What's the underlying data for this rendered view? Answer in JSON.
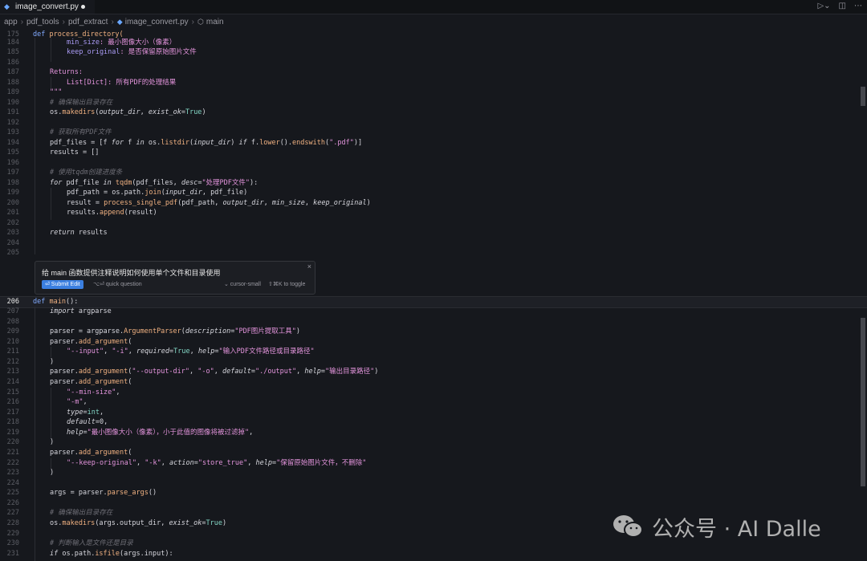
{
  "tab": {
    "filename": "image_convert.py"
  },
  "breadcrumbs": [
    "app",
    "pdf_tools",
    "pdf_extract",
    "image_convert.py",
    "main"
  ],
  "watermark": {
    "text": "公众号 · AI Dalle"
  },
  "inline_edit": {
    "prompt": "给 main 函数提供注释说明如何使用单个文件和目录使用",
    "submit_label": "⏎ Submit Edit",
    "quick_label": "⌥⏎ quick question",
    "model_label": "⌄ cursor-small",
    "toggle_label": "⇧⌘K to toggle"
  },
  "line_numbers": [
    "175",
    "184",
    "185",
    "186",
    "187",
    "188",
    "189",
    "190",
    "191",
    "192",
    "193",
    "194",
    "195",
    "196",
    "197",
    "198",
    "199",
    "200",
    "201",
    "202",
    "203",
    "204",
    "205",
    "206",
    "207",
    "208",
    "209",
    "210",
    "211",
    "212",
    "213",
    "214",
    "215",
    "216",
    "217",
    "218",
    "219",
    "220",
    "221",
    "222",
    "223",
    "224",
    "225",
    "226",
    "227",
    "228",
    "229",
    "230",
    "231"
  ],
  "code": {
    "l175_kw": "def ",
    "l175_fn": "process_directory(",
    "l184_a": "min_size",
    "l184_b": ": 最小图像大小（像素）",
    "l185_a": "keep_original",
    "l185_b": ": 是否保留原始图片文件",
    "l187": "Returns:",
    "l188": "List[Dict]: 所有PDF的处理结果",
    "l189": "\"\"\"",
    "l190": "# 确保输出目录存在",
    "l191_a": "os.",
    "l191_fn": "makedirs",
    "l191_b": "(",
    "l191_p1": "output_dir",
    "l191_c": ", ",
    "l191_p2": "exist_ok",
    "l191_d": "=",
    "l191_e": "True",
    "l191_f": ")",
    "l193": "# 获取所有PDF文件",
    "l194_a": "pdf_files = [f ",
    "l194_kw1": "for",
    "l194_b": " f ",
    "l194_kw2": "in",
    "l194_c": " os.",
    "l194_fn": "listdir",
    "l194_d": "(",
    "l194_p": "input_dir",
    "l194_e": ") ",
    "l194_kw3": "if",
    "l194_f": " f.",
    "l194_fn2": "lower",
    "l194_g": "().",
    "l194_fn3": "endswith",
    "l194_h": "(",
    "l194_s": "\".pdf\"",
    "l194_i": ")]",
    "l195": "results = []",
    "l197": "# 使用tqdm创建进度条",
    "l198_kw": "for",
    "l198_a": " pdf_file ",
    "l198_kw2": "in",
    "l198_b": " ",
    "l198_fn": "tqdm",
    "l198_c": "(pdf_files, ",
    "l198_p": "desc",
    "l198_d": "=",
    "l198_s": "\"处理PDF文件\"",
    "l198_e": "):",
    "l199_a": "pdf_path = os.path.",
    "l199_fn": "join",
    "l199_b": "(",
    "l199_p": "input_dir",
    "l199_c": ", pdf_file)",
    "l200_a": "result = ",
    "l200_fn": "process_single_pdf",
    "l200_b": "(pdf_path, ",
    "l200_p1": "output_dir",
    "l200_c": ", ",
    "l200_p2": "min_size",
    "l200_d": ", ",
    "l200_p3": "keep_original",
    "l200_e": ")",
    "l201_a": "results.",
    "l201_fn": "append",
    "l201_b": "(result)",
    "l203_kw": "return",
    "l203_a": " results",
    "l206_kw": "def ",
    "l206_fn": "main",
    "l206_a": "():",
    "l207_kw": "import",
    "l207_a": " argparse",
    "l209_a": "parser = argparse.",
    "l209_fn": "ArgumentParser",
    "l209_b": "(",
    "l209_p": "description",
    "l209_c": "=",
    "l209_s": "\"PDF图片提取工具\"",
    "l209_d": ")",
    "l210_a": "parser.",
    "l210_fn": "add_argument",
    "l210_b": "(",
    "l211_s1": "\"--input\"",
    "l211_a": ", ",
    "l211_s2": "\"-i\"",
    "l211_b": ", ",
    "l211_p": "required",
    "l211_c": "=",
    "l211_v": "True",
    "l211_d": ", ",
    "l211_p2": "help",
    "l211_e": "=",
    "l211_s3": "\"输入PDF文件路径或目录路径\"",
    "l212": ")",
    "l213_a": "parser.",
    "l213_fn": "add_argument",
    "l213_b": "(",
    "l213_s1": "\"--output-dir\"",
    "l213_c": ", ",
    "l213_s2": "\"-o\"",
    "l213_d": ", ",
    "l213_p": "default",
    "l213_e": "=",
    "l213_s3": "\"./output\"",
    "l213_f": ", ",
    "l213_p2": "help",
    "l213_g": "=",
    "l213_s4": "\"输出目录路径\"",
    "l213_h": ")",
    "l214_a": "parser.",
    "l214_fn": "add_argument",
    "l214_b": "(",
    "l215_s": "\"--min-size\"",
    "l215_a": ",",
    "l216_s": "\"-m\"",
    "l216_a": ",",
    "l217_p": "type",
    "l217_a": "=",
    "l217_v": "int",
    "l217_b": ",",
    "l218_p": "default",
    "l218_a": "=0,",
    "l219_p": "help",
    "l219_a": "=",
    "l219_s": "\"最小图像大小（像素），小于此值的图像将被过滤掉\"",
    "l219_b": ",",
    "l220": ")",
    "l221_a": "parser.",
    "l221_fn": "add_argument",
    "l221_b": "(",
    "l222_s1": "\"--keep-original\"",
    "l222_a": ", ",
    "l222_s2": "\"-k\"",
    "l222_b": ", ",
    "l222_p": "action",
    "l222_c": "=",
    "l222_s3": "\"store_true\"",
    "l222_d": ", ",
    "l222_p2": "help",
    "l222_e": "=",
    "l222_s4": "\"保留原始图片文件，不删除\"",
    "l223": ")",
    "l225_a": "args = parser.",
    "l225_fn": "parse_args",
    "l225_b": "()",
    "l227": "# 确保输出目录存在",
    "l228_a": "os.",
    "l228_fn": "makedirs",
    "l228_b": "(args.output_dir, ",
    "l228_p": "exist_ok",
    "l228_c": "=",
    "l228_v": "True",
    "l228_d": ")",
    "l230": "# 判断输入是文件还是目录",
    "l231_kw": "if",
    "l231_a": " os.path.",
    "l231_fn": "isfile",
    "l231_b": "(args.input):"
  }
}
